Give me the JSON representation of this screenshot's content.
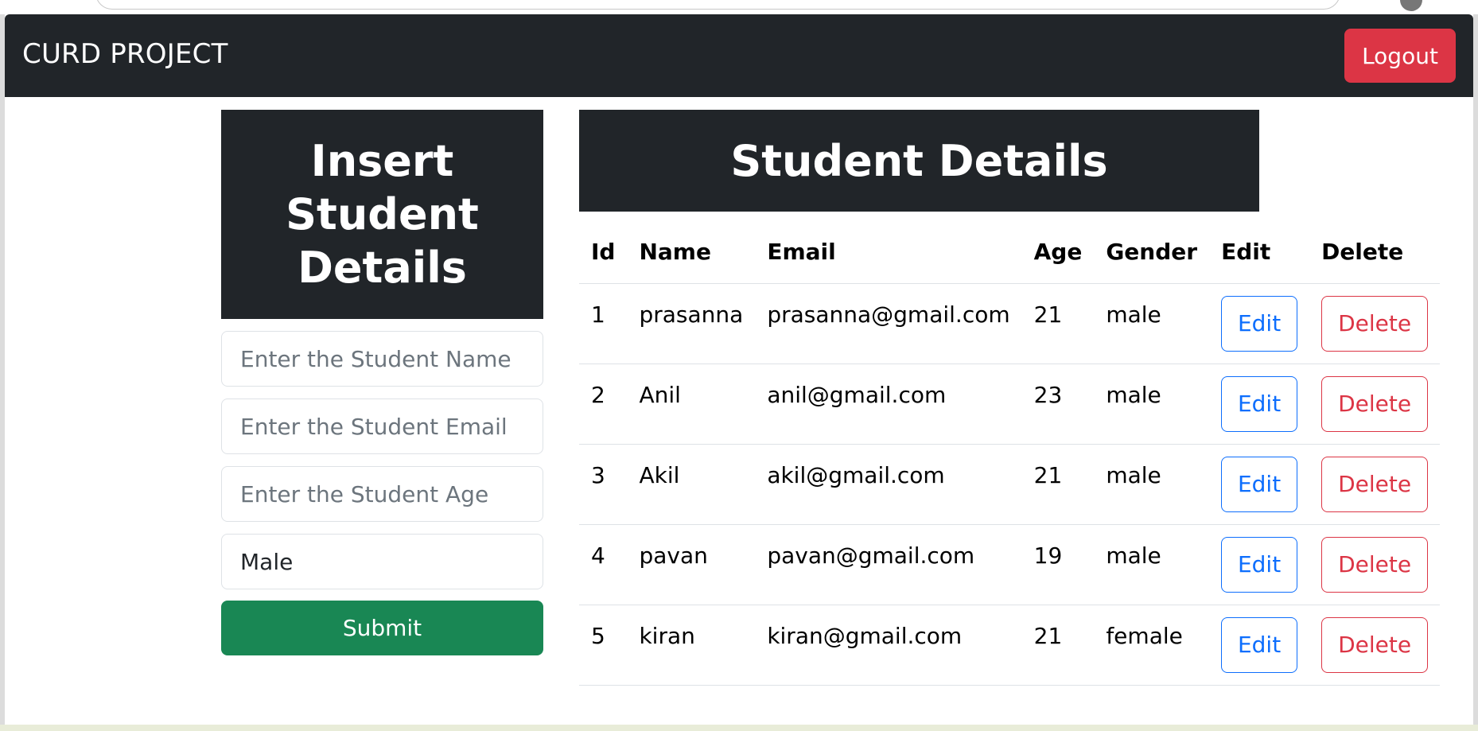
{
  "navbar": {
    "brand": "CURD PROJECT",
    "logout_label": "Logout"
  },
  "form": {
    "title": "Insert Student Details",
    "name_placeholder": "Enter the Student Name",
    "email_placeholder": "Enter the Student Email",
    "age_placeholder": "Enter the Student Age",
    "gender_selected": "Male",
    "submit_label": "Submit"
  },
  "table": {
    "title": "Student Details",
    "headers": [
      "Id",
      "Name",
      "Email",
      "Age",
      "Gender",
      "Edit",
      "Delete"
    ],
    "rows": [
      {
        "id": "1",
        "name": "prasanna",
        "email": "prasanna@gmail.com",
        "age": "21",
        "gender": "male"
      },
      {
        "id": "2",
        "name": "Anil",
        "email": "anil@gmail.com",
        "age": "23",
        "gender": "male"
      },
      {
        "id": "3",
        "name": "Akil",
        "email": "akil@gmail.com",
        "age": "21",
        "gender": "male"
      },
      {
        "id": "4",
        "name": "pavan",
        "email": "pavan@gmail.com",
        "age": "19",
        "gender": "male"
      },
      {
        "id": "5",
        "name": "kiran",
        "email": "kiran@gmail.com",
        "age": "21",
        "gender": "female"
      }
    ],
    "edit_label": "Edit",
    "delete_label": "Delete"
  },
  "colors": {
    "navbar_bg": "#212529",
    "logout_bg": "#dc3545",
    "submit_bg": "#198754",
    "edit_color": "#0d6efd",
    "delete_color": "#dc3545"
  }
}
